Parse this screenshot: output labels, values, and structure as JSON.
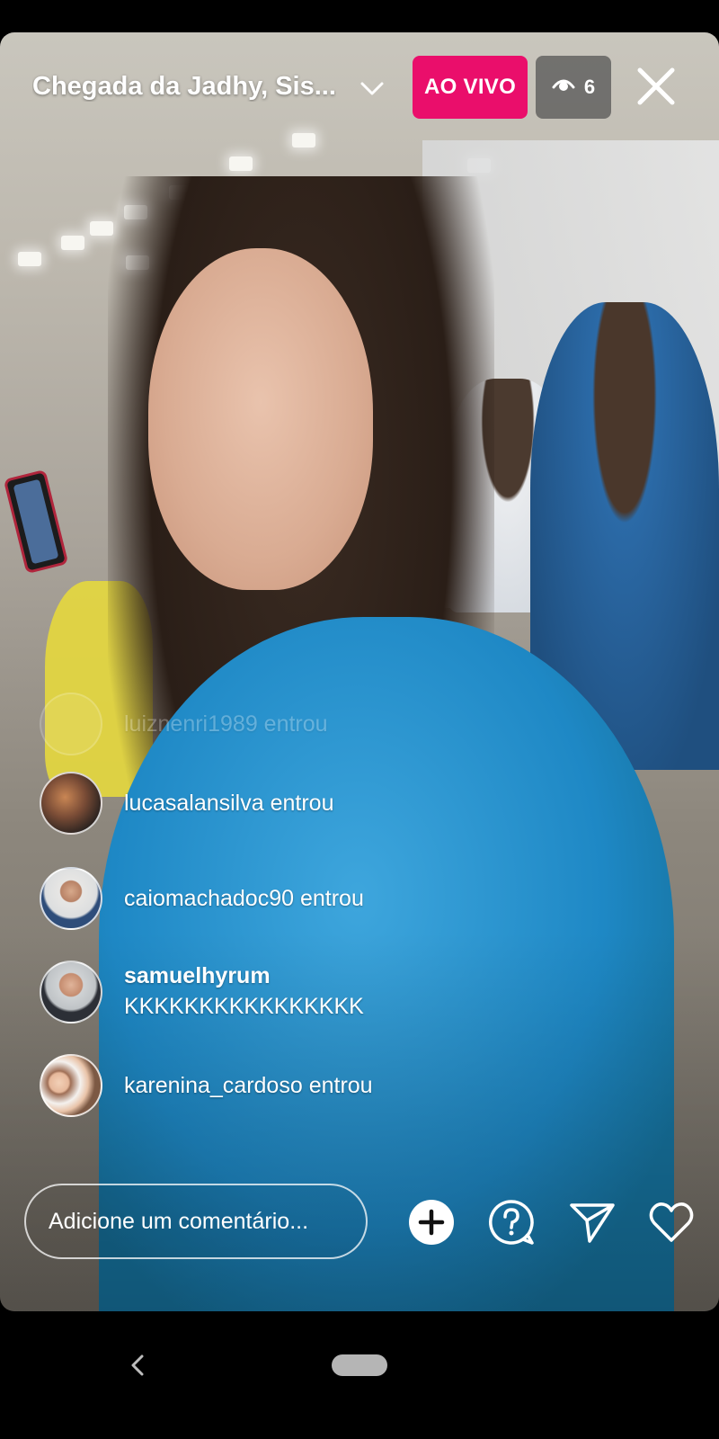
{
  "header": {
    "title": "Chegada da Jadhy, Sis...",
    "live_badge": "AO VIVO",
    "viewer_count": "6",
    "icons": {
      "dropdown": "chevron-down-icon",
      "viewers": "eye-icon",
      "close": "close-icon"
    }
  },
  "comments": {
    "faded": {
      "text": "luiznenri1989 entrou"
    },
    "items": [
      {
        "user": "",
        "text": "lucasalansilva entrou"
      },
      {
        "user": "",
        "text": "caiomachadoc90 entrou"
      },
      {
        "user": "samuelhyrum",
        "text": "KKKKKKKKKKKKKKKK"
      },
      {
        "user": "",
        "text": "karenina_cardoso entrou"
      }
    ]
  },
  "footer": {
    "comment_placeholder": "Adicione um comentário...",
    "icons": [
      "add-icon",
      "question-icon",
      "send-icon",
      "heart-icon"
    ]
  },
  "colors": {
    "live_badge": "#ea0e6b",
    "viewer_badge": "#505050",
    "shirt_blue": "#1e88c5"
  },
  "navbar": {
    "icons": [
      "back-icon",
      "home-pill-icon"
    ]
  }
}
